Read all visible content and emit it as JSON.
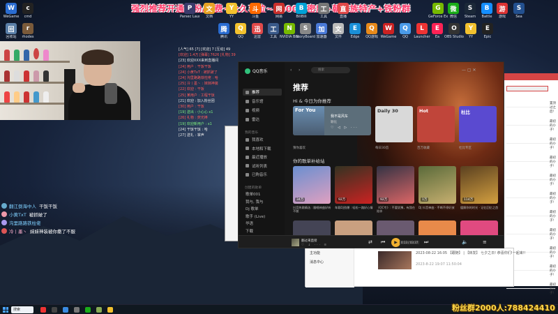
{
  "banner": {
    "text": "强烈推荐开通钻粉/续费~永久车位~3000亲密度+朝鲜族特产+铁粉群"
  },
  "desktop": {
    "top_row": [
      {
        "label": "WeGame",
        "color": "#2a6cd1"
      },
      {
        "label": "cmd",
        "color": "#222"
      },
      {
        "label": "Parsec Launcher",
        "color": "#3b3b6b"
      },
      {
        "label": "文档",
        "color": "#e7a325"
      },
      {
        "label": "YY",
        "color": "#f2c12e"
      },
      {
        "label": "斗鱼",
        "color": "#ff6a00"
      },
      {
        "label": "网易",
        "color": "#c9302c"
      },
      {
        "label": "BiliBili",
        "color": "#00a1d6"
      },
      {
        "label": "工具",
        "color": "#777"
      },
      {
        "label": "直播",
        "color": "#e04a4a"
      },
      {
        "label": "GeForce Experience",
        "color": "#76b900"
      },
      {
        "label": "Steam",
        "color": "#1b2838"
      },
      {
        "label": "微信",
        "color": "#1aad19"
      },
      {
        "label": "Battle",
        "color": "#148eff"
      },
      {
        "label": "游戏",
        "color": "#d33"
      },
      {
        "label": "Sea",
        "color": "#23508f"
      }
    ],
    "second_row": [
      {
        "label": "回收站",
        "color": "#5a7fa8"
      },
      {
        "label": "rhodes",
        "color": "#7a5a3a"
      },
      {
        "label": "腾讯",
        "color": "#2a6cd1"
      },
      {
        "label": "QQ",
        "color": "#f2c12e"
      },
      {
        "label": "迅雷",
        "color": "#e04a4a"
      },
      {
        "label": "工具",
        "color": "#3a5a8a"
      },
      {
        "label": "NVIDIA Broadcast",
        "color": "#76b900"
      },
      {
        "label": "StoryBoard",
        "color": "#888"
      },
      {
        "label": "加速器",
        "color": "#4a7ad9"
      },
      {
        "label": "文件",
        "color": "#bbb"
      },
      {
        "label": "Edge",
        "color": "#1a8fd8"
      },
      {
        "label": "QQ游戏",
        "color": "#e88a1a"
      },
      {
        "label": "WeGame",
        "color": "#c22"
      },
      {
        "label": "QQ",
        "color": "#4a9ae8"
      },
      {
        "label": "Launcher",
        "color": "#e33"
      },
      {
        "label": "Ea",
        "color": "#f25"
      },
      {
        "label": "OBS Studio",
        "color": "#333"
      },
      {
        "label": "YY",
        "color": "#f2c12e"
      },
      {
        "label": "Epic",
        "color": "#222"
      }
    ]
  },
  "chatlog": [
    {
      "t": "[人气] 65 [7] [欢迎] 7 [互动] 49",
      "c": "c-white"
    },
    {
      "t": "[欢迎] 1.4万 [弹幕] 7626 [礼物] 39",
      "c": "c-red"
    },
    {
      "t": "[23] 欢迎XXX来到直播间",
      "c": "c-white"
    },
    {
      "t": "[24] 用户 : 干饭干饭",
      "c": "c-red"
    },
    {
      "t": "[24] 小黄TxT : 被抓破了",
      "c": "c-red"
    },
    {
      "t": "[24] 沟里路路铁柱佬 : 哈",
      "c": "c-red"
    },
    {
      "t": "[25] 冷丨墨丶 : 妹妹神装",
      "c": "c-red"
    },
    {
      "t": "[22] 欢迎 : 干饭",
      "c": "c-red"
    },
    {
      "t": "[25] 某用户 : 工程干饭",
      "c": "c-red"
    },
    {
      "t": "[21] 欢迎 : 加入粉丝团",
      "c": "c-white"
    },
    {
      "t": "[30] 用户 : 干饭",
      "c": "c-red"
    },
    {
      "t": "[19] 送出 : 小心心 x1",
      "c": "c-green"
    },
    {
      "t": "[26] 礼物 : 荧光棒",
      "c": "c-red"
    },
    {
      "t": "[19] 欢迎新用户 : x1",
      "c": "c-green"
    },
    {
      "t": "[24] 干饭干饭 : 哈",
      "c": "c-white"
    },
    {
      "t": "[27] 送礼 : 掌声",
      "c": "c-white"
    }
  ],
  "danmaku": [
    {
      "name": "翻江倒海中人",
      "msg": "干饭干饭",
      "color": "#7fd0ff",
      "avatar": "#6ac"
    },
    {
      "name": "小黄TxT",
      "msg": "被抓破了",
      "color": "#7fd0ff",
      "avatar": "#e9a"
    },
    {
      "name": "沟里路路铁柱佬",
      "msg": "",
      "color": "#7fd0ff",
      "avatar": "#a9e"
    },
    {
      "name": "冷丨墨丶",
      "msg": "妹妹神装被你撒了不服",
      "color": "#ffb3d0",
      "avatar": "#d55"
    }
  ],
  "qq": {
    "app_name": "QQ音乐",
    "search_placeholder": "搜索",
    "nav": [
      {
        "label": "推荐",
        "active": true
      },
      {
        "label": "音乐馆",
        "active": false
      },
      {
        "label": "视频",
        "active": false
      },
      {
        "label": "雷达",
        "active": false
      }
    ],
    "nav_head_mine": "我的音乐",
    "mine": [
      "我喜欢",
      "本地和下载",
      "最近播放",
      "试听列表",
      "已购音乐"
    ],
    "nav_head_created": "创建的歌单",
    "created": [
      "歌单001",
      "我与, 我与",
      "Dj 歌单",
      "歌手 (Live)",
      "华语",
      "下载"
    ],
    "title": "推荐",
    "subtitle": "Hi & 今日为你推荐",
    "section2": "你的歌单补给站",
    "card_big": {
      "tag": "For You",
      "song": "我不是风车",
      "artist": "颖化",
      "caption": "猜你喜欢"
    },
    "cards": [
      {
        "tag": "Daily 30",
        "caption": "每日30首",
        "bg": "#d9d9d9",
        "fg": "#333"
      },
      {
        "tag": "Hot",
        "caption": "百万收藏",
        "bg": "#c0453a",
        "fg": "#fff"
      },
      {
        "tag": "杜比",
        "caption": "杜比专区",
        "bg": "#5a4ad0",
        "fg": "#fff"
      }
    ],
    "tiles": [
      {
        "plays": "34万",
        "caption": "抖音热歌精选 : 翻唱神曲好听不腻",
        "bg": "linear-gradient(160deg,#6a8fd0,#e0a0c0)"
      },
      {
        "plays": "92万",
        "caption": "车载DJ劲爆 : 轻松一路好心情",
        "bg": "linear-gradient(160deg,#332,#c22)"
      },
      {
        "plays": "92万",
        "caption": "《OC专》: 不要犹豫，有我在陪伴",
        "bg": "linear-gradient(160deg,#334,#d66)"
      },
      {
        "plays": "1万",
        "caption": "DJ 抖音神曲 · 不断不停好放",
        "bg": "linear-gradient(160deg,#5a6a3a,#c8b070)"
      },
      {
        "plays": "114万",
        "caption": "缓解你的时光 · 记忆回忆之首",
        "bg": "linear-gradient(160deg,#5a4020,#d4a040)"
      }
    ],
    "tiles2": [
      "#445",
      "#c9a080",
      "#6a5a70",
      "#e88a4a",
      "#e04a80"
    ],
    "player": {
      "title": "翻过来直接",
      "actions": "♡ ↓ ··· ≡",
      "tooltip": "0:13 / 03:37"
    },
    "win_controls": "— ▢ ✕"
  },
  "redwin": {
    "rows": [
      "置顶过之后!",
      "最初的小子!",
      "最初的小子!",
      "最初的小子!",
      "最初的小子!",
      "最初的小子!",
      "最初的小子!",
      "最初的小子!",
      "最初的小子!",
      "最初的小子!",
      "最初的小子!"
    ]
  },
  "bottomwin": {
    "side": [
      "主功能",
      "消息中心"
    ],
    "line1": "2023-08-22 16:05 【跟随】 | 【转发】 七夕之日! 恭喜你们!一起来!!",
    "line2": "2023-8-22 19:07  11:50:04"
  },
  "taskbar": {
    "search": "搜索",
    "icons": [
      "#e33",
      "#444",
      "#3a8ae0",
      "#777",
      "#1aad19",
      "#8a5",
      "#f2c12e"
    ]
  },
  "fans": {
    "text": "粉丝群2000人:788424410"
  }
}
